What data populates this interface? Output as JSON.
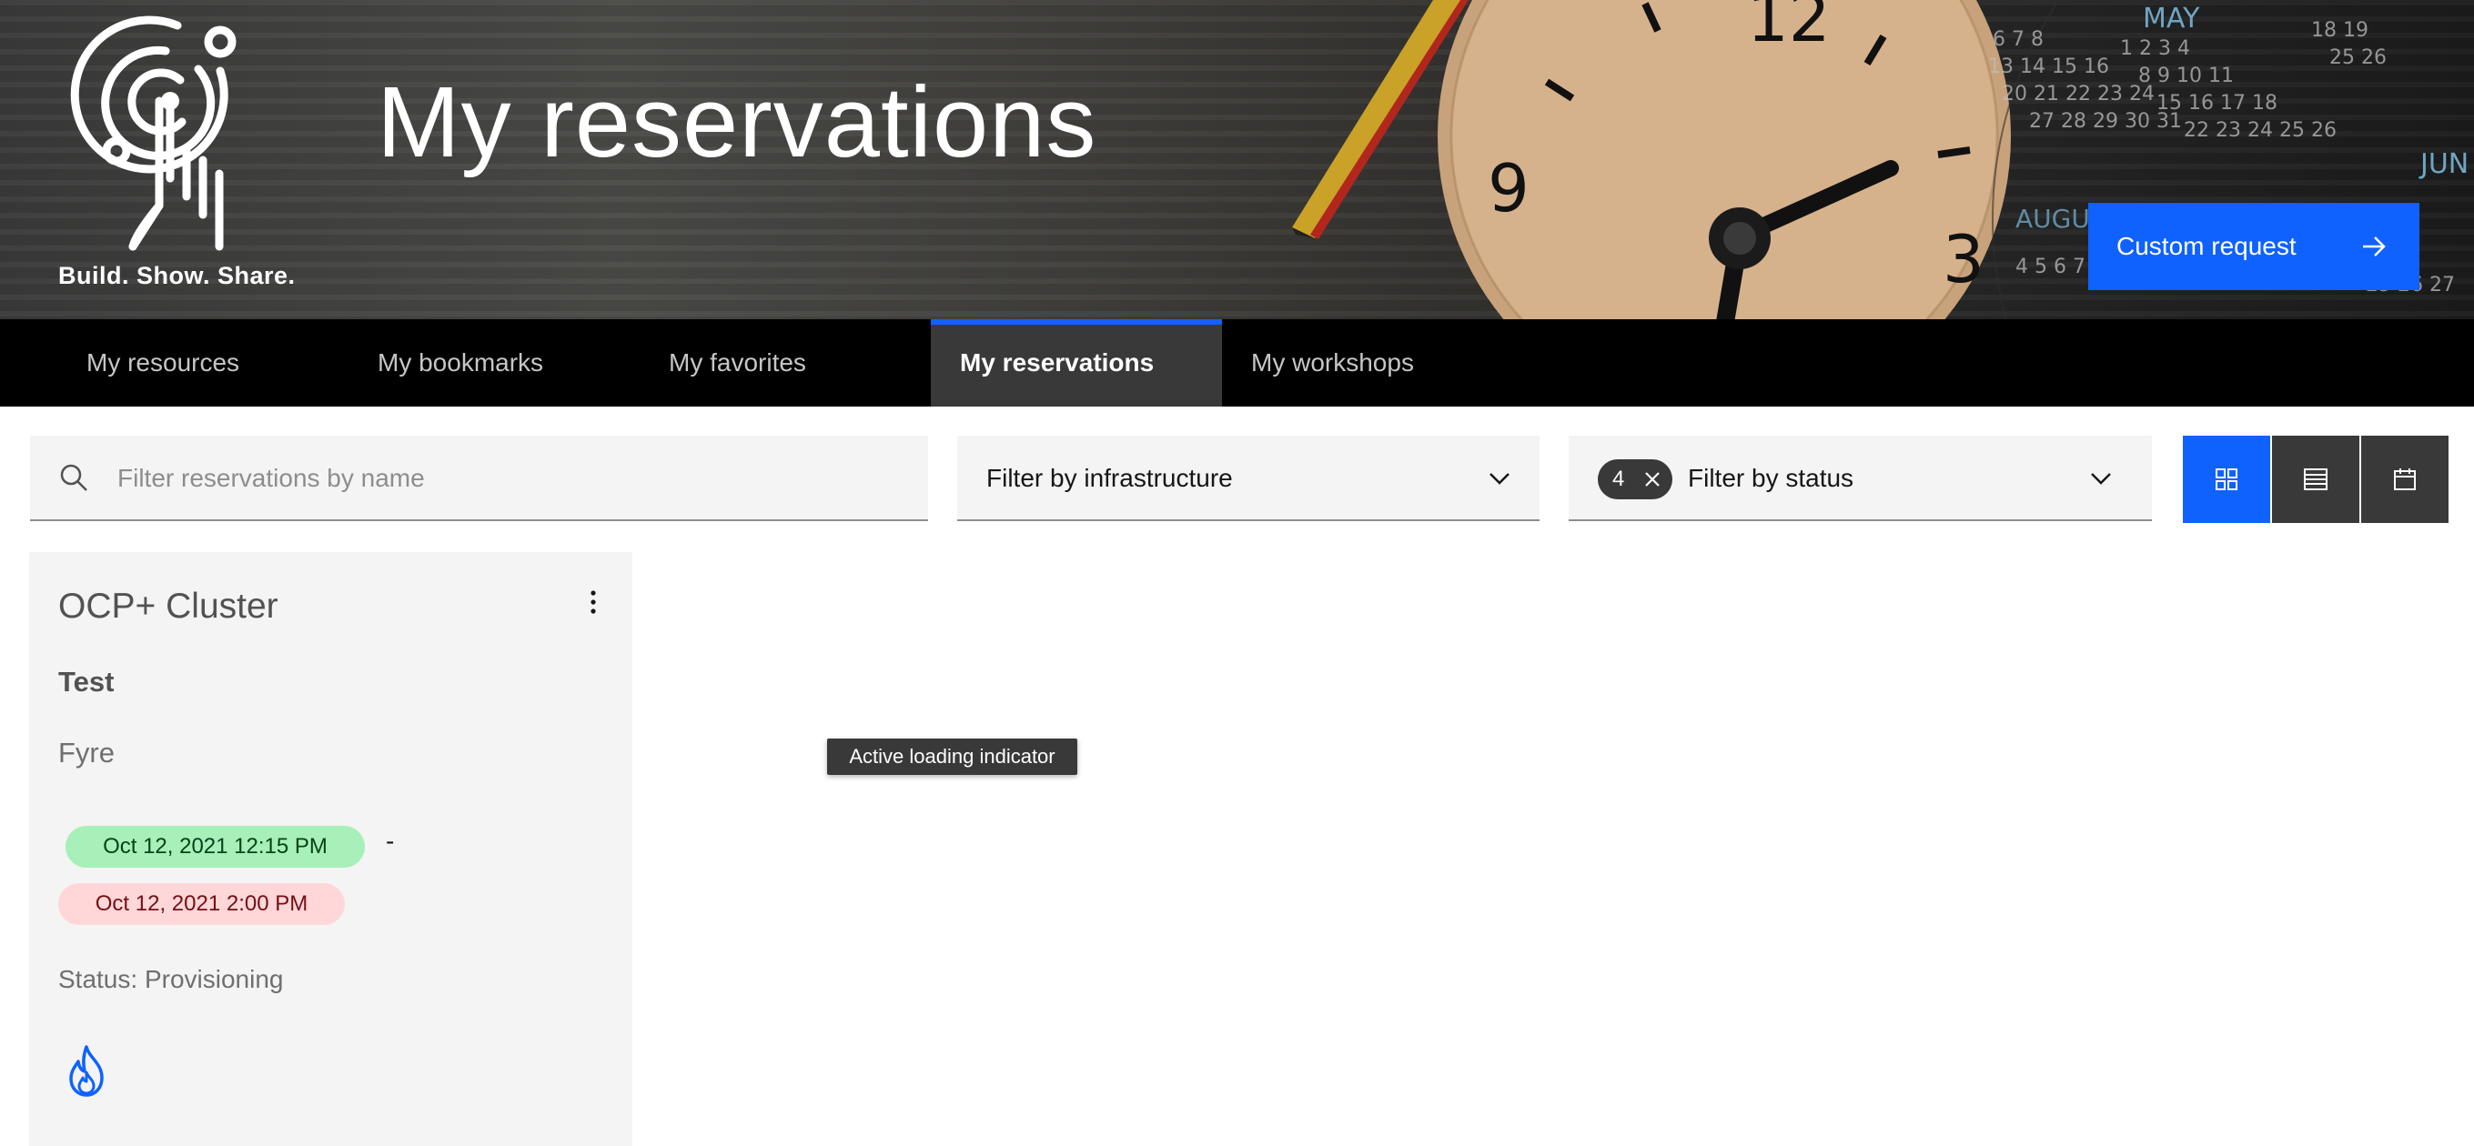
{
  "hero": {
    "title": "My reservations",
    "tagline": "Build. Show. Share.",
    "custom_request_label": "Custom request",
    "clock_numbers": [
      "12",
      "9",
      "3"
    ],
    "calendar_text": [
      "MAY",
      "AUGUST",
      "JUN"
    ]
  },
  "tabs": [
    {
      "label": "My resources",
      "active": false
    },
    {
      "label": "My bookmarks",
      "active": false
    },
    {
      "label": "My favorites",
      "active": false
    },
    {
      "label": "My reservations",
      "active": true
    },
    {
      "label": "My workshops",
      "active": false
    }
  ],
  "filters": {
    "search_placeholder": "Filter reservations by name",
    "search_value": "",
    "infrastructure_label": "Filter by infrastructure",
    "status_label": "Filter by status",
    "status_selected_count": "4"
  },
  "view_switcher": {
    "options": [
      {
        "icon": "grid-icon",
        "active": true
      },
      {
        "icon": "list-icon",
        "active": false
      },
      {
        "icon": "calendar-icon",
        "active": false
      }
    ]
  },
  "reservations": [
    {
      "title": "OCP+ Cluster",
      "name": "Test",
      "infrastructure": "Fyre",
      "start": "Oct 12, 2021 12:15 PM",
      "separator": "-",
      "end": "Oct 12, 2021 2:00 PM",
      "status": "Status: Provisioning",
      "icon": "fyre-flame-icon"
    }
  ],
  "tooltip": "Active loading indicator",
  "colors": {
    "primary_blue": "#0f62fe",
    "tab_bar": "#000000",
    "active_tab": "#393939",
    "card_bg": "#f4f4f4",
    "start_pill": "#a7f0ba",
    "end_pill": "#ffd7d9"
  }
}
